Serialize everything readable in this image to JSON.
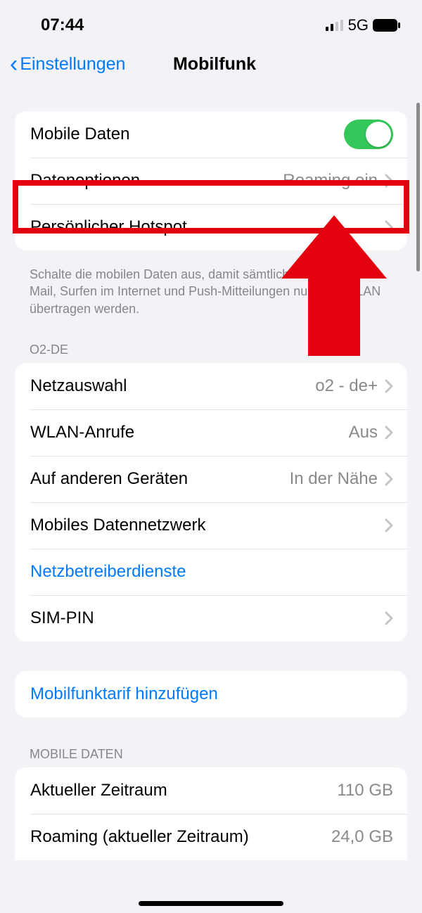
{
  "status": {
    "time": "07:44",
    "network_label": "5G"
  },
  "nav": {
    "back_label": "Einstellungen",
    "title": "Mobilfunk"
  },
  "group1": {
    "mobile_data_label": "Mobile Daten",
    "mobile_data_on": true,
    "data_options_label": "Datenoptionen",
    "data_options_detail": "Roaming ein",
    "hotspot_label": "Persönlicher Hotspot",
    "footer": "Schalte die mobilen Daten aus, damit sämtliche Daten wie E-Mail, Surfen im Internet und Push-Mitteilungen nur über WLAN übertragen werden."
  },
  "group2": {
    "header": "O2-DE",
    "network_selection_label": "Netzauswahl",
    "network_selection_detail": "o2 - de+",
    "wlan_calls_label": "WLAN-Anrufe",
    "wlan_calls_detail": "Aus",
    "other_devices_label": "Auf anderen Geräten",
    "other_devices_detail": "In der Nähe",
    "mobile_data_network_label": "Mobiles Datennetzwerk",
    "carrier_services_label": "Netzbetreiberdienste",
    "sim_pin_label": "SIM-PIN"
  },
  "group3": {
    "add_plan_label": "Mobilfunktarif hinzufügen"
  },
  "group4": {
    "header": "MOBILE DATEN",
    "current_period_label": "Aktueller Zeitraum",
    "current_period_value": "110 GB",
    "roaming_period_label": "Roaming (aktueller Zeitraum)",
    "roaming_period_value": "24,0 GB"
  },
  "annotation": {
    "highlight_target": "data-options-row",
    "arrow_points_to": "data-options-row"
  }
}
